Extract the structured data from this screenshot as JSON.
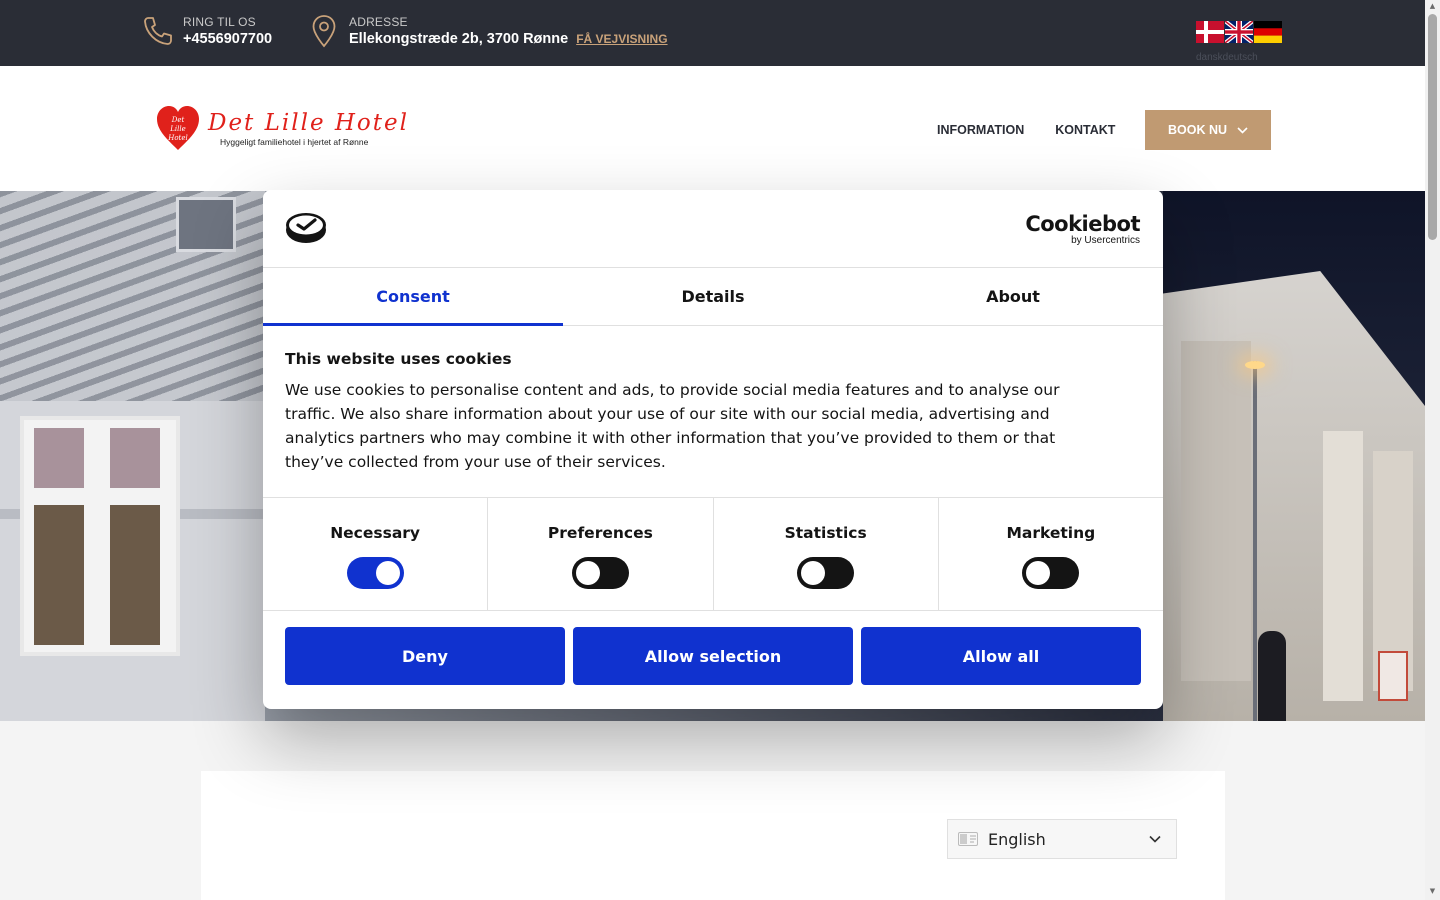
{
  "topbar": {
    "phone_label": "RING TIL OS",
    "phone_value": "+4556907700",
    "address_label": "ADRESSE",
    "address_value": "Ellekongstræde 2b, 3700 Rønne",
    "directions_link": "FÅ VEJVISNING",
    "flag_note": "danskdeutsch",
    "flags": [
      "flag-dk-icon",
      "flag-uk-icon",
      "flag-de-icon"
    ],
    "background_color": "#2a2d36",
    "accent_color": "#c9a27a"
  },
  "header": {
    "logo": {
      "heart_lines": [
        "Det",
        "Lille",
        "Hotel"
      ],
      "title": "Det Lille Hotel",
      "subtitle": "Hyggeligt familiehotel i hjertet af Rønne"
    },
    "nav": [
      "INFORMATION",
      "KONTAKT"
    ],
    "book_button": "BOOK NU",
    "book_color": "#c09a72"
  },
  "cookie_dialog": {
    "brand_name": "Cookiebot",
    "brand_by": "by Usercentrics",
    "tabs": [
      {
        "label": "Consent",
        "active": true
      },
      {
        "label": "Details",
        "active": false
      },
      {
        "label": "About",
        "active": false
      }
    ],
    "title": "This website uses cookies",
    "text": "We use cookies to personalise content and ads, to provide social media features and to analyse our traffic. We also share information about your use of our site with our social media, advertising and analytics partners who may combine it with other information that you’ve provided to them or that they’ve collected from your use of their services.",
    "preferences": [
      {
        "label": "Necessary",
        "on": true
      },
      {
        "label": "Preferences",
        "on": false
      },
      {
        "label": "Statistics",
        "on": false
      },
      {
        "label": "Marketing",
        "on": false
      }
    ],
    "buttons": {
      "deny": "Deny",
      "allow_selection": "Allow selection",
      "allow_all": "Allow all"
    },
    "accent_color": "#1032cf"
  },
  "content": {
    "language_select": "English"
  }
}
